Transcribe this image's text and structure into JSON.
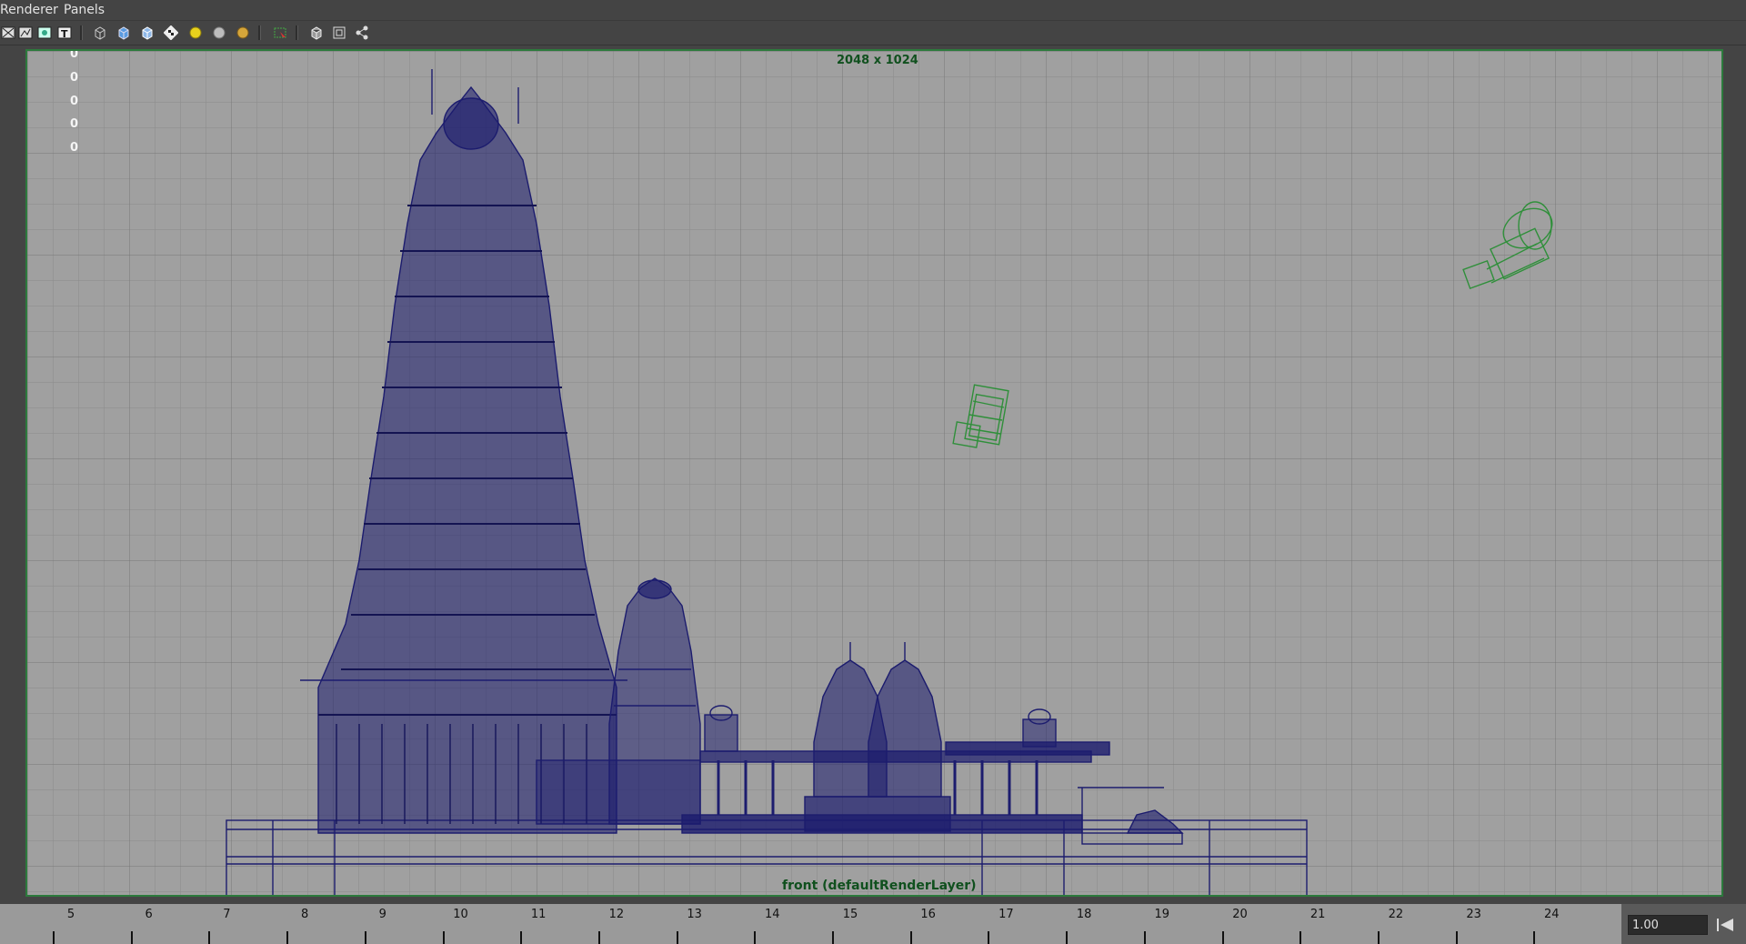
{
  "menubar": {
    "items": [
      "Renderer",
      "Panels"
    ]
  },
  "toolbar": {
    "icons": [
      "wireframe-icon",
      "image-plane-icon",
      "texture-icon",
      "text-icon",
      "wireframe-cube-icon",
      "smooth-shade-cube-icon",
      "shaded-wireframe-cube-icon",
      "checker-icon",
      "light-yellow-icon",
      "light-grey-icon",
      "light-gold-icon",
      "select-camera-icon",
      "isolate-cube-icon",
      "frame-icon",
      "share-icon"
    ]
  },
  "viewport": {
    "resolution_label": "2048 x 1024",
    "camera_label": "front (defaultRenderLayer)",
    "hud_values": [
      "0",
      "0",
      "0",
      "0",
      "0"
    ],
    "wireframe_color": "#1c1c6e",
    "camera_color": "#2f8f3a"
  },
  "timeline": {
    "ticks": [
      "5",
      "6",
      "7",
      "8",
      "9",
      "10",
      "11",
      "12",
      "13",
      "14",
      "15",
      "16",
      "17",
      "18",
      "19",
      "20",
      "21",
      "22",
      "23",
      "24"
    ],
    "current_value": "1.00"
  }
}
